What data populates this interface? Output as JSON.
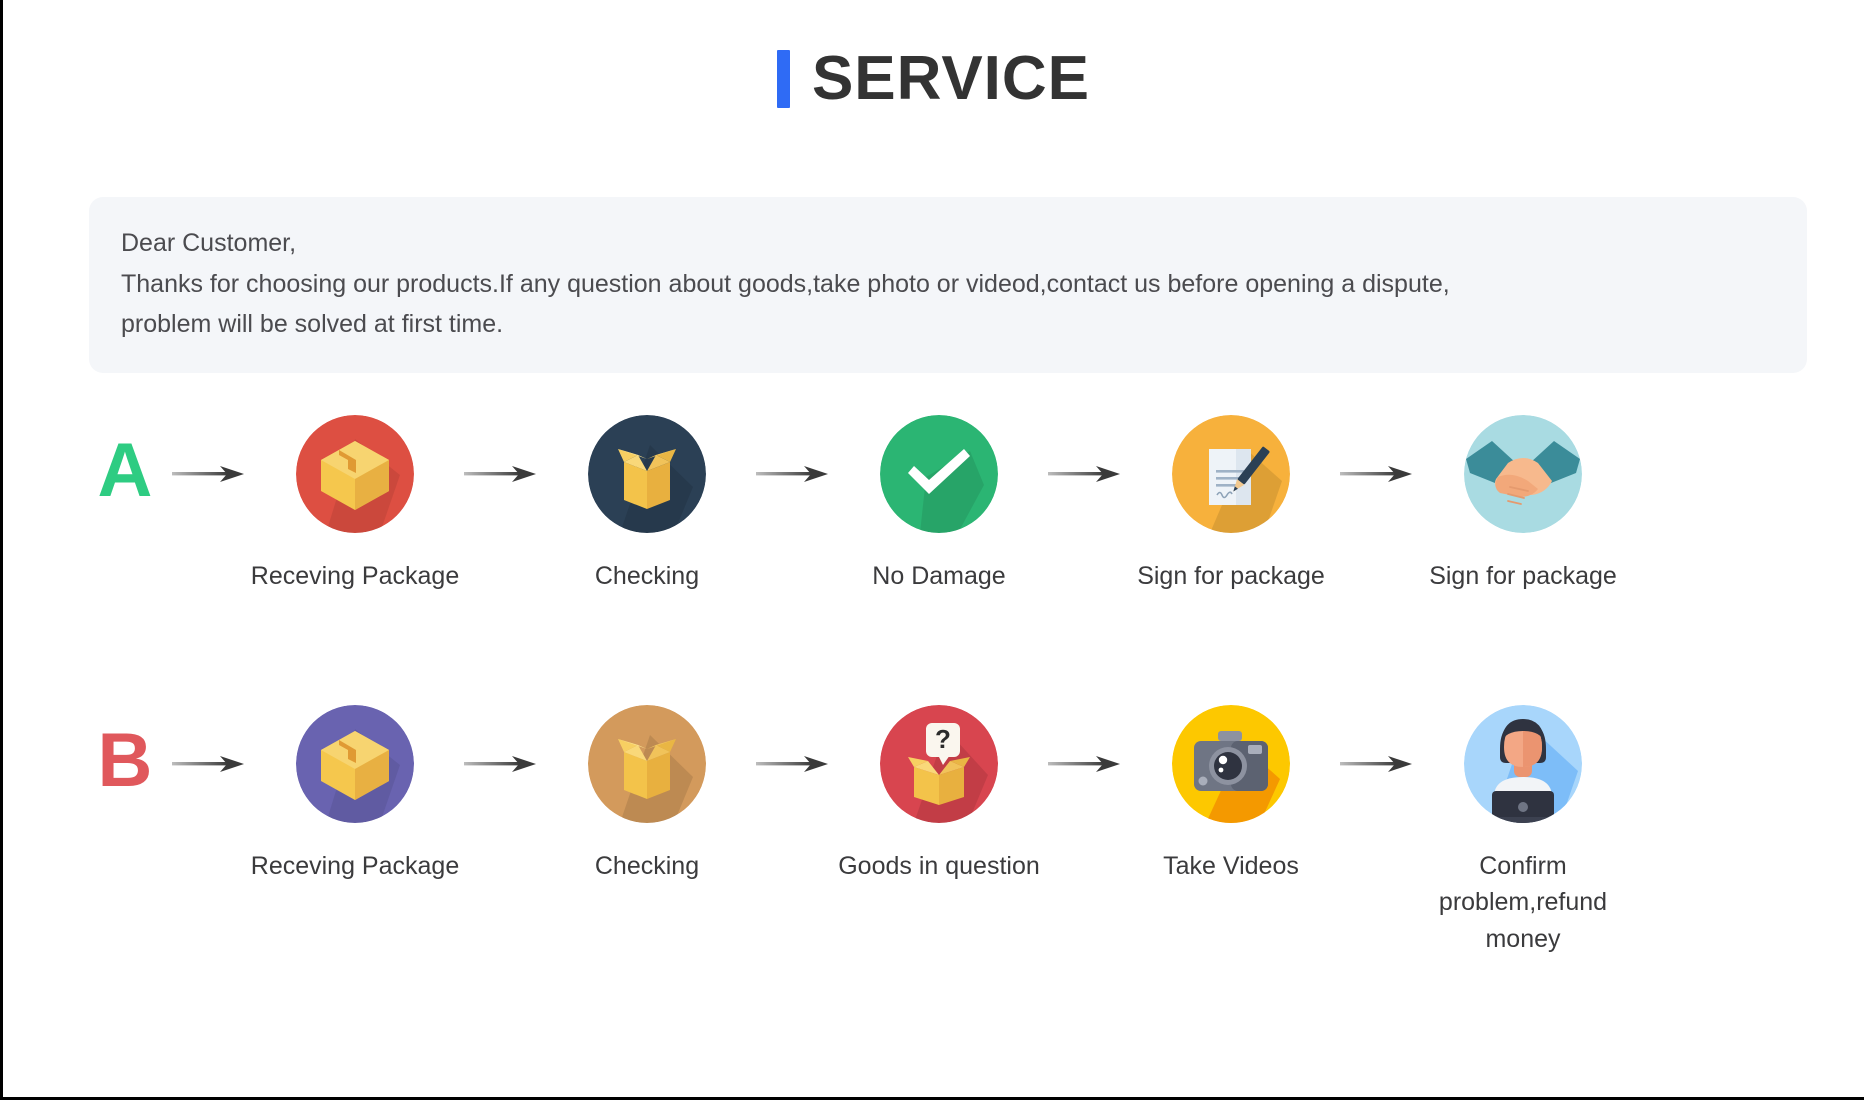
{
  "page": {
    "title": "SERVICE",
    "accent_color": "#2f6bf5",
    "title_color": "#333333",
    "background": "#ffffff"
  },
  "notice": {
    "background": "#f4f6f9",
    "lines": [
      "Dear Customer,",
      "Thanks for choosing our products.If any question about goods,take photo or videod,contact us before opening a dispute,",
      "problem will be solved at first time."
    ]
  },
  "flows": [
    {
      "letter": "A",
      "letter_color": "#2ecc82",
      "steps": [
        {
          "label": "Receving Package",
          "icon": "sealed-package-icon",
          "circle_color": "#dd4f42"
        },
        {
          "label": "Checking",
          "icon": "open-box-icon",
          "circle_color": "#2b4055"
        },
        {
          "label": "No Damage",
          "icon": "check-mark-icon",
          "circle_color": "#2bb573"
        },
        {
          "label": "Sign for package",
          "icon": "document-pen-icon",
          "circle_color": "#f7b13c"
        },
        {
          "label": "Sign for package",
          "icon": "handshake-icon",
          "circle_color": "#a9dbe2"
        }
      ]
    },
    {
      "letter": "B",
      "letter_color": "#e0585c",
      "steps": [
        {
          "label": "Receving Package",
          "icon": "sealed-package-icon",
          "circle_color": "#6963b0"
        },
        {
          "label": "Checking",
          "icon": "open-box-icon",
          "circle_color": "#d39a5c"
        },
        {
          "label": "Goods in question",
          "icon": "question-box-icon",
          "circle_color": "#d8454f"
        },
        {
          "label": "Take Videos",
          "icon": "camera-icon",
          "circle_color": "#fdc800"
        },
        {
          "label": "Confirm  problem,refund money",
          "icon": "support-person-icon",
          "circle_color": "#a8d6fb"
        }
      ]
    }
  ],
  "arrow": {
    "color": "#4a4a4a",
    "name": "arrow-right-icon"
  }
}
